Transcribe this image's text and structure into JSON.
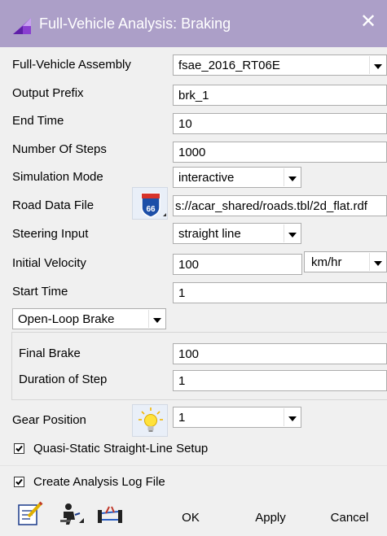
{
  "window": {
    "title": "Full-Vehicle Analysis: Braking",
    "close": "✕"
  },
  "form": {
    "assembly": {
      "label": "Full-Vehicle Assembly",
      "value": "fsae_2016_RT06E"
    },
    "output_prefix": {
      "label": "Output Prefix",
      "value": "brk_1"
    },
    "end_time": {
      "label": "End Time",
      "value": "10"
    },
    "steps": {
      "label": "Number Of Steps",
      "value": "1000"
    },
    "sim_mode": {
      "label": "Simulation Mode",
      "value": "interactive"
    },
    "road": {
      "label": "Road Data File",
      "value": "s://acar_shared/roads.tbl/2d_flat.rdf",
      "icon_text": "66"
    },
    "steering": {
      "label": "Steering Input",
      "value": "straight line"
    },
    "velocity": {
      "label": "Initial Velocity",
      "value": "100",
      "unit": "km/hr"
    },
    "start_time": {
      "label": "Start Time",
      "value": "1"
    },
    "brake_mode": {
      "value": "Open-Loop Brake"
    },
    "final_brake": {
      "label": "Final Brake",
      "value": "100"
    },
    "duration": {
      "label": "Duration of Step",
      "value": "1"
    },
    "gear": {
      "label": "Gear Position",
      "value": "1"
    },
    "quasi_static": {
      "label": "Quasi-Static Straight-Line Setup",
      "checked": true
    },
    "log_file": {
      "label": "Create Analysis Log File",
      "checked": true
    }
  },
  "buttons": {
    "ok": "OK",
    "apply": "Apply",
    "cancel": "Cancel"
  },
  "colors": {
    "titlebar": "#ac9fc8",
    "icon_purple": "#8a3fd1"
  }
}
